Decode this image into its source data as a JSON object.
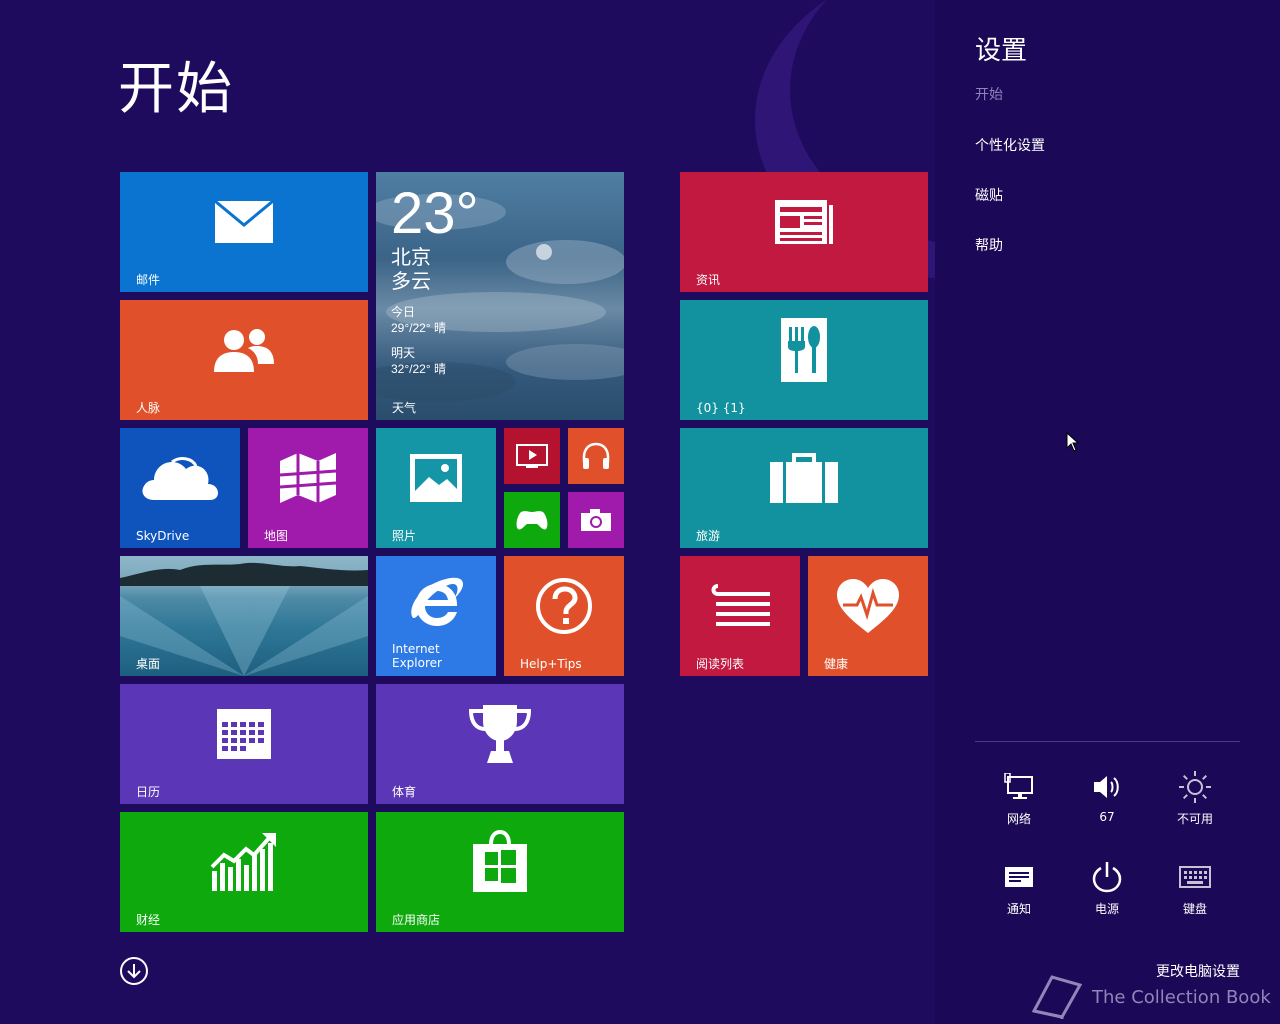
{
  "start": {
    "title": "开始",
    "tiles": {
      "mail": "邮件",
      "people": "人脉",
      "weather": {
        "temp": "23°",
        "city": "北京",
        "condition": "多云",
        "today_label": "今日",
        "today": "29°/22° 晴",
        "tomorrow_label": "明天",
        "tomorrow": "32°/22° 晴",
        "label": "天气"
      },
      "skydrive": "SkyDrive",
      "maps": "地图",
      "photos": "照片",
      "desktop": "桌面",
      "ie": "Internet\nExplorer",
      "help": "Help+Tips",
      "calendar": "日历",
      "sports": "体育",
      "finance": "财经",
      "store": "应用商店",
      "news": "资讯",
      "food": "{0} {1}",
      "travel": "旅游",
      "reading": "阅读列表",
      "health": "健康"
    }
  },
  "settings_pane": {
    "title": "设置",
    "subtitle": "开始",
    "links": [
      "个性化设置",
      "磁贴",
      "帮助"
    ],
    "quick": [
      {
        "icon": "network-icon",
        "label": "网络"
      },
      {
        "icon": "volume-icon",
        "label": "67"
      },
      {
        "icon": "brightness-icon",
        "label": "不可用"
      },
      {
        "icon": "notifications-icon",
        "label": "通知"
      },
      {
        "icon": "power-icon",
        "label": "电源"
      },
      {
        "icon": "keyboard-icon",
        "label": "键盘"
      }
    ],
    "change_pc_settings": "更改电脑设置"
  },
  "watermark": "The Collection Book",
  "colors": {
    "background": "#1f0b5e",
    "pane": "#1b0856",
    "mail": "#0a74d0",
    "people": "#e0512b",
    "skydrive": "#0f54bd",
    "maps": "#a01aab",
    "photos": "#1496a6",
    "ie": "#2d7ae6",
    "help": "#e0512b",
    "calendar": "#5b37b7",
    "sports": "#5b37b7",
    "finance": "#0da90d",
    "store": "#0da90d",
    "news": "#c1193f",
    "food": "#12919e",
    "travel": "#12919e",
    "reading": "#c1193f",
    "health": "#e0512b"
  }
}
